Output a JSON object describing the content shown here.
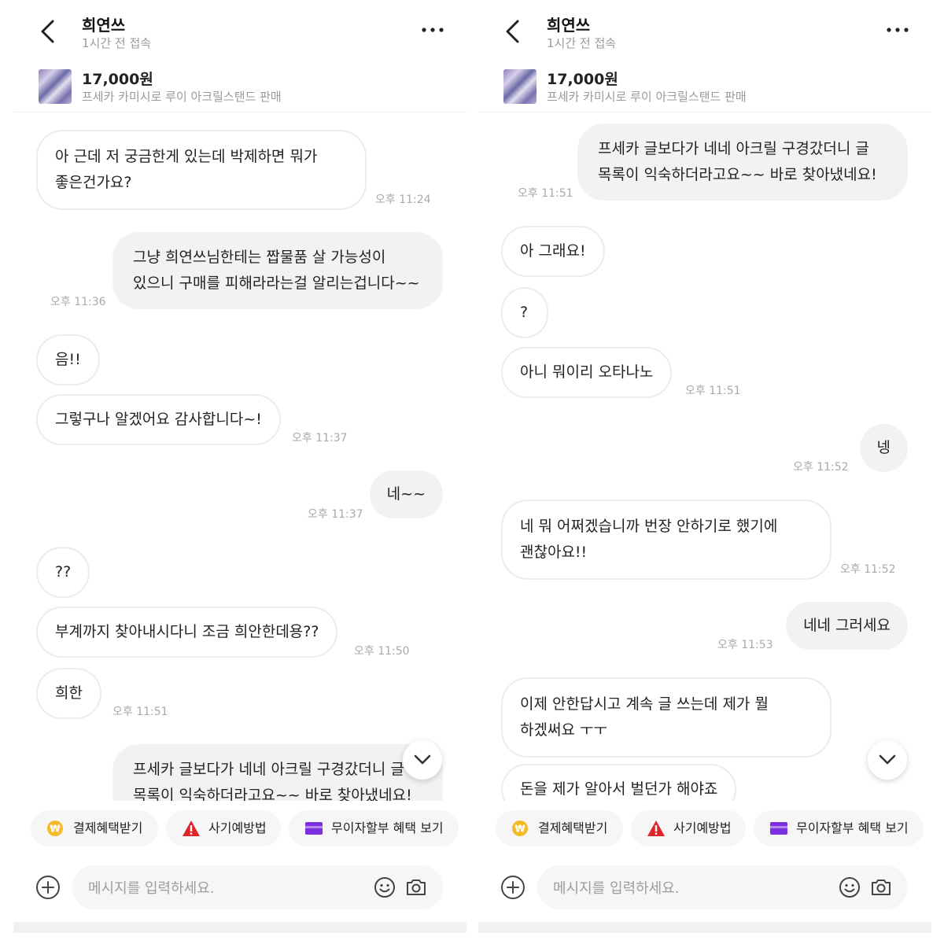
{
  "left": {
    "header": {
      "name": "희연쓰",
      "status": "1시간 전 접속"
    },
    "product": {
      "price": "17,000원",
      "title": "프세카 카미시로 루이 아크릴스탠드 판매"
    },
    "messages": [
      {
        "text": "아 근데 저 궁금한게 있는데 박제하면 뭐가\n좋은건가요?",
        "time": "오후 11:24"
      },
      {
        "text": "그냥 희연쓰님한테는 짭물품 살 가능성이\n있으니 구매를 피해라라는걸 알리는겁니다~~",
        "time": "오후 11:36"
      },
      {
        "text": "음!!"
      },
      {
        "text": "그렇구나 알겠어요 감사합니다~!",
        "time": "오후 11:37"
      },
      {
        "text": "네~~",
        "time": "오후 11:37"
      },
      {
        "text": "??"
      },
      {
        "text": "부계까지 찾아내시다니 조금 희안한데용??",
        "time": "오후 11:50"
      },
      {
        "text": "희한",
        "time": "오후 11:51"
      },
      {
        "text": "프세카 글보다가 네네 아크릴 구경갔더니 글\n목록이 익숙하더라고요~~ 바로 찾아냈네요!"
      }
    ]
  },
  "right": {
    "header": {
      "name": "희연쓰",
      "status": "1시간 전 접속"
    },
    "product": {
      "price": "17,000원",
      "title": "프세카 카미시로 루이 아크릴스탠드 판매"
    },
    "messages": [
      {
        "text": "프세카 글보다가 네네 아크릴 구경갔더니 글\n목록이 익숙하더라고요~~ 바로 찾아냈네요!",
        "time": "오후 11:51"
      },
      {
        "text": "아 그래요!"
      },
      {
        "text": "?"
      },
      {
        "text": "아니 뭐이리 오타나노",
        "time": "오후 11:51"
      },
      {
        "text": "넹",
        "time": "오후 11:52"
      },
      {
        "text": "네 뭐 어쩌겠습니까 번장 안하기로 했기에\n괜찮아요!!",
        "time": "오후 11:52"
      },
      {
        "text": "네네 그러세요",
        "time": "오후 11:53"
      },
      {
        "text": "이제 안한답시고 계속 글 쓰는데 제가 뭘\n하겠써요 ㅜㅜ"
      },
      {
        "text": "돈을 제가 알아서 벌던가 해야죠"
      }
    ]
  },
  "quick_actions": [
    "결제혜택받기",
    "사기예방법",
    "무이자할부 혜택 보기"
  ],
  "input": {
    "placeholder": "메시지를 입력하세요."
  },
  "icons": {
    "back": "back-chevron-icon",
    "more": "more-dots-icon",
    "scroll_down": "chevron-down-icon",
    "payment": "won-coin-icon",
    "fraud": "warning-triangle-icon",
    "installment": "card-icon",
    "add": "plus-circle-icon",
    "emoji": "smiley-icon",
    "camera": "camera-icon"
  },
  "colors": {
    "coin": "#f6b928",
    "warning": "#e0262b",
    "card": "#7b2fe0",
    "outgoing_bubble": "#f2f2f2"
  }
}
